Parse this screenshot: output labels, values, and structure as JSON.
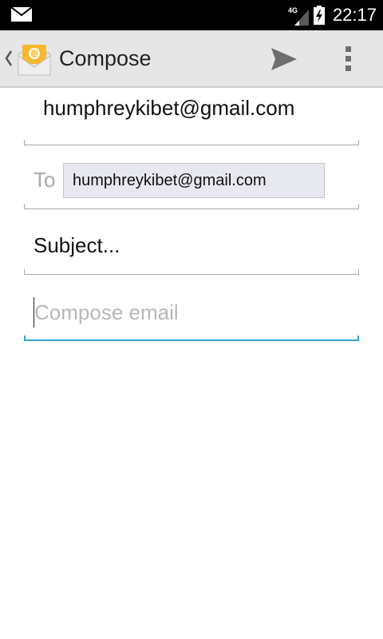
{
  "status_bar": {
    "network": "4G",
    "time": "22:17",
    "icons": [
      "mail-icon",
      "signal-icon",
      "battery-charging-icon"
    ]
  },
  "action_bar": {
    "title": "Compose",
    "icons": [
      "chevron-left-icon",
      "email-app-icon",
      "send-icon",
      "overflow-menu-icon"
    ]
  },
  "compose": {
    "from": "humphreykibet@gmail.com",
    "to_label": "To",
    "recipients": [
      "humphreykibet@gmail.com"
    ],
    "subject_placeholder": "Subject...",
    "body_placeholder": "Compose email"
  },
  "colors": {
    "status_bar": "#000000",
    "action_bar": "#e6e6e6",
    "focus_accent": "#33a3c9",
    "chip_background": "#e8e8f0"
  }
}
